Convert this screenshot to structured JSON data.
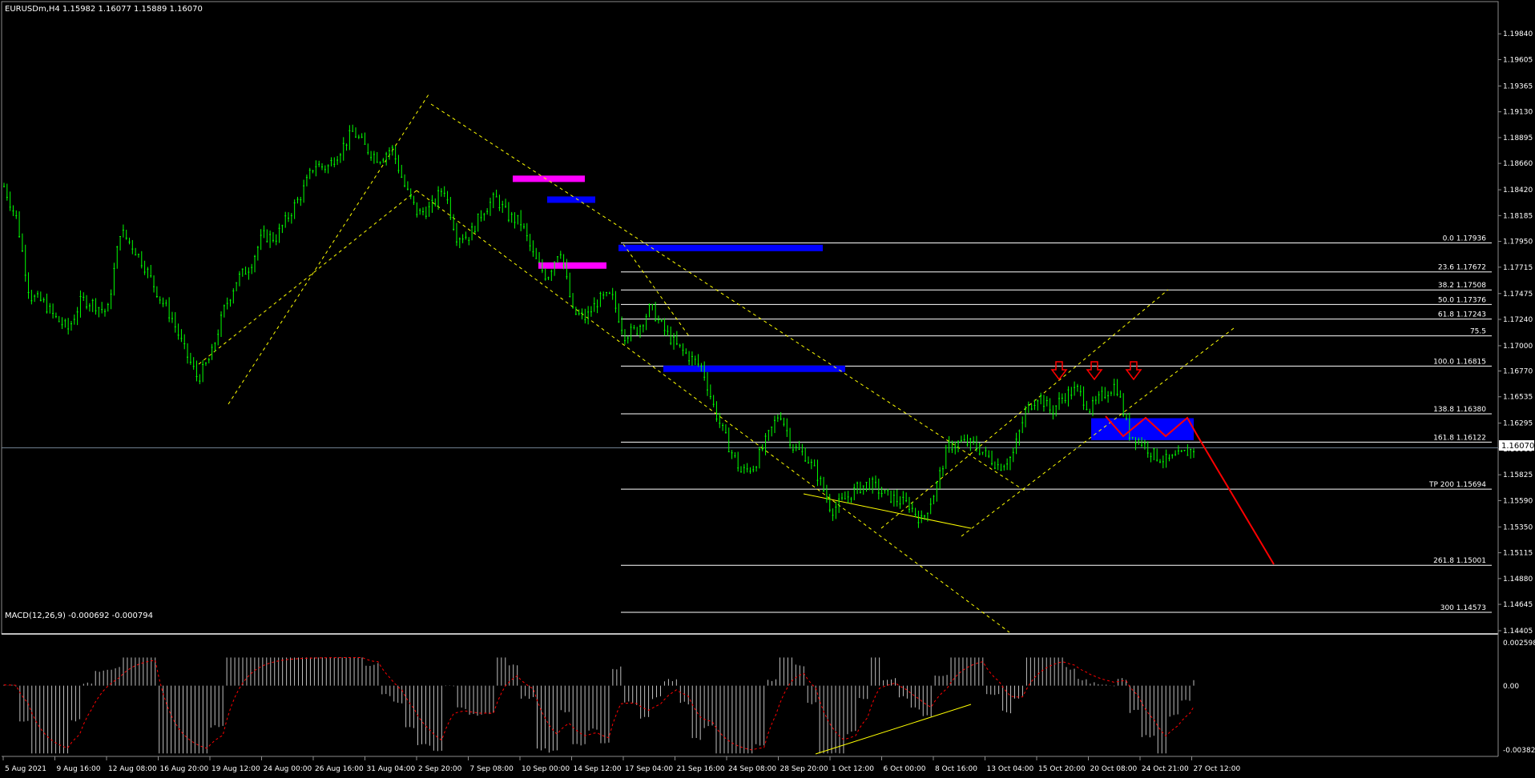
{
  "chart_data": [
    {
      "type": "candlestick",
      "title": "EURUSDm,H4  1.15982 1.16077 1.15889 1.16070",
      "symbol": "EURUSDm",
      "timeframe": "H4",
      "ohlc_header": {
        "open": "1.15982",
        "high": "1.16077",
        "low": "1.15889",
        "close": "1.16070"
      },
      "current_price": "1.16070",
      "ylim": [
        1.14405,
        1.20075
      ],
      "y_ticks": [
        "1.19840",
        "1.19605",
        "1.19365",
        "1.19130",
        "1.18895",
        "1.18660",
        "1.18420",
        "1.18185",
        "1.17950",
        "1.17715",
        "1.17475",
        "1.17240",
        "1.17000",
        "1.16770",
        "1.16535",
        "1.16295",
        "1.16060",
        "1.15825",
        "1.15590",
        "1.15350",
        "1.15115",
        "1.14880",
        "1.14645",
        "1.14405"
      ],
      "x_ticks": [
        "5 Aug 2021",
        "9 Aug 16:00",
        "12 Aug 08:00",
        "16 Aug 20:00",
        "19 Aug 12:00",
        "24 Aug 00:00",
        "26 Aug 16:00",
        "31 Aug 04:00",
        "2 Sep 20:00",
        "7 Sep 08:00",
        "10 Sep 00:00",
        "14 Sep 12:00",
        "17 Sep 04:00",
        "21 Sep 16:00",
        "24 Sep 08:00",
        "28 Sep 20:00",
        "1 Oct 12:00",
        "6 Oct 00:00",
        "8 Oct 16:00",
        "13 Oct 04:00",
        "15 Oct 20:00",
        "20 Oct 08:00",
        "24 Oct 21:00",
        "27 Oct 12:00"
      ],
      "price_path": [
        1.1845,
        1.1815,
        1.1745,
        1.174,
        1.1725,
        1.1715,
        1.1742,
        1.1738,
        1.173,
        1.1805,
        1.179,
        1.177,
        1.1745,
        1.1725,
        1.1695,
        1.167,
        1.169,
        1.1732,
        1.176,
        1.1772,
        1.18,
        1.1798,
        1.1818,
        1.1838,
        1.1865,
        1.1862,
        1.1878,
        1.1895,
        1.188,
        1.187,
        1.188,
        1.1845,
        1.182,
        1.1825,
        1.1845,
        1.18,
        1.18,
        1.1822,
        1.1835,
        1.1818,
        1.1812,
        1.178,
        1.1762,
        1.179,
        1.173,
        1.1725,
        1.1742,
        1.1745,
        1.171,
        1.1715,
        1.1735,
        1.1715,
        1.17,
        1.169,
        1.168,
        1.164,
        1.161,
        1.1585,
        1.159,
        1.1615,
        1.164,
        1.1608,
        1.16,
        1.158,
        1.155,
        1.156,
        1.157,
        1.1575,
        1.1565,
        1.156,
        1.1555,
        1.154,
        1.1568,
        1.1608,
        1.1612,
        1.161,
        1.16,
        1.159,
        1.16,
        1.164,
        1.1655,
        1.164,
        1.1655,
        1.166,
        1.1642,
        1.1655,
        1.1665,
        1.162,
        1.1612,
        1.16,
        1.1595,
        1.16,
        1.1606
      ],
      "fibonacci_levels": [
        {
          "label": "0.0 1.17936",
          "price": 1.17936
        },
        {
          "label": "23.6 1.17672",
          "price": 1.17672
        },
        {
          "label": "38.2 1.17508",
          "price": 1.17508
        },
        {
          "label": "50.0 1.17376",
          "price": 1.17376
        },
        {
          "label": "61.8 1.17243",
          "price": 1.17243
        },
        {
          "label": "75.5",
          "price": 1.1709
        },
        {
          "label": "100.0 1.16815",
          "price": 1.16815
        },
        {
          "label": "138.8 1.16380",
          "price": 1.1638
        },
        {
          "label": "161.8 1.16122",
          "price": 1.16122
        },
        {
          "label": "TP 200 1.15694",
          "price": 1.15694
        },
        {
          "label": "261.8 1.15001",
          "price": 1.15001
        },
        {
          "label": "300 1.14573",
          "price": 1.14573
        }
      ],
      "zones": [
        {
          "color": "#ff00ff",
          "price": 1.1852
        },
        {
          "color": "#0000ff",
          "price": 1.1833
        },
        {
          "color": "#ff00ff",
          "price": 1.1773
        },
        {
          "color": "#0000ff",
          "price": 1.1789
        },
        {
          "color": "#0000ff",
          "price": 1.1679
        },
        {
          "color": "#0000ff",
          "price_top": 1.1634,
          "price_bottom": 1.1614
        }
      ],
      "projection": {
        "color": "#ff0000",
        "target": 1.15001
      },
      "markers": {
        "count": 3,
        "shape": "down-arrow",
        "color": "#ff0000"
      },
      "colors": {
        "background": "#000000",
        "candles": "#00ff00",
        "grid_lines": "#ffffff",
        "channel": "#ffff00",
        "price_line": "#708090"
      }
    },
    {
      "type": "bar",
      "title": "MACD(12,26,9) -0.000692 -0.000794",
      "indicator": "MACD(12,26,9)",
      "main_value": "-0.000692",
      "signal_value": "-0.000794",
      "ylim": [
        -0.003829,
        0.002598
      ],
      "y_ticks": [
        "0.002598",
        "0.00",
        "-0.003829"
      ],
      "colors": {
        "histogram": "#c0c0c0",
        "signal": "#ff0000",
        "divergence": "#ffff00"
      }
    }
  ]
}
